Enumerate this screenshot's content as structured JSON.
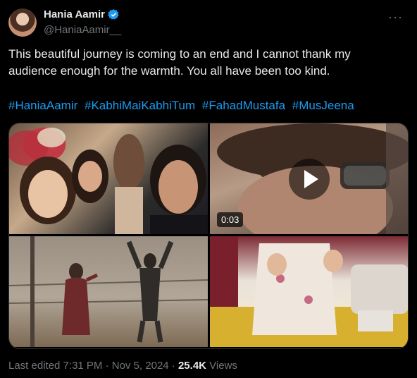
{
  "author": {
    "name": "Hania Aamir",
    "handle": "@HaniaAamir__"
  },
  "tweet": {
    "text": "This beautiful journey is coming to an end and I cannot thank my\naudience enough for the warmth. You all have been too kind.",
    "hashtags": [
      "#HaniaAamir",
      "#KabhiMaiKabhiTum",
      "#FahadMustafa",
      "#MusJeena"
    ]
  },
  "media": {
    "video_duration": "0:03"
  },
  "meta": {
    "last_edited": "Last edited 7:31 PM · Nov 5, 2024 · ",
    "views_count": "25.4K",
    "views_label": " Views"
  },
  "icons": {
    "verified": "verified-badge-icon",
    "more": "more-options-icon",
    "play": "play-icon"
  },
  "colors": {
    "accent": "#1d9bf0",
    "text": "#e7e9ea",
    "muted": "#71767b",
    "background": "#000000"
  }
}
